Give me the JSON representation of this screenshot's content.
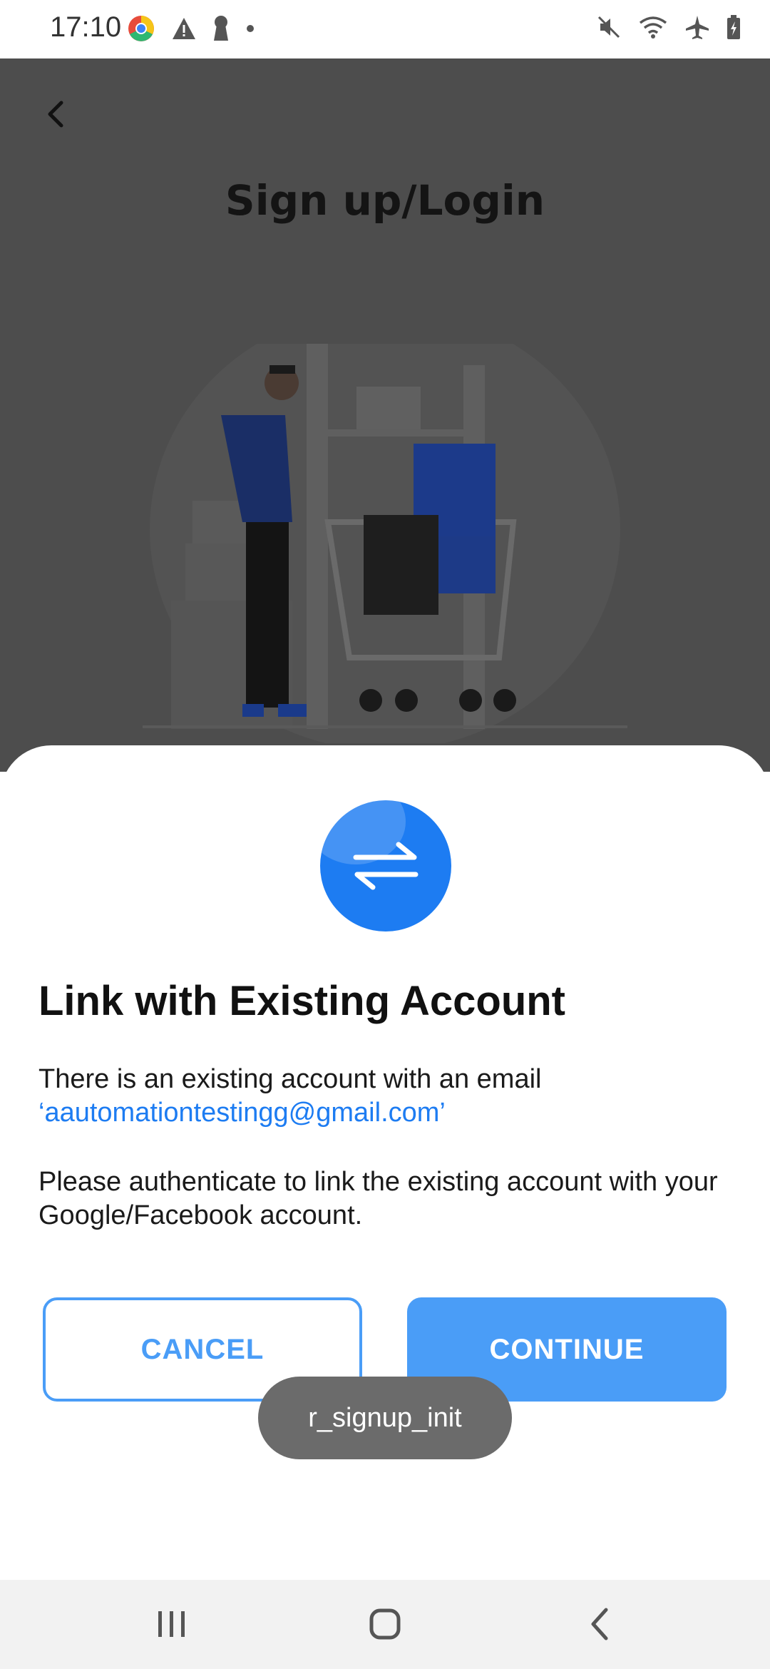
{
  "status_bar": {
    "time": "17:10",
    "left_icons": [
      "chrome-icon",
      "warning-icon",
      "keyhole-icon",
      "dot-icon"
    ],
    "right_icons": [
      "mute-icon",
      "wifi-icon",
      "airplane-icon",
      "battery-icon"
    ]
  },
  "background": {
    "title": "Sign up/Login",
    "dim_color": "#4d4d4d"
  },
  "sheet": {
    "icon": "link-swap-icon",
    "title": "Link with Existing Account",
    "message": "There is an existing account with an email",
    "email": "‘aautomationtestingg@gmail.com’",
    "message2": "Please authenticate to link the existing account with your Google/Facebook account.",
    "cancel_label": "CANCEL",
    "continue_label": "CONTINUE",
    "accent": "#4a9df7"
  },
  "toast": {
    "text": "r_signup_init"
  },
  "nav_bar": {
    "icons": [
      "recents-icon",
      "home-icon",
      "back-icon"
    ]
  }
}
